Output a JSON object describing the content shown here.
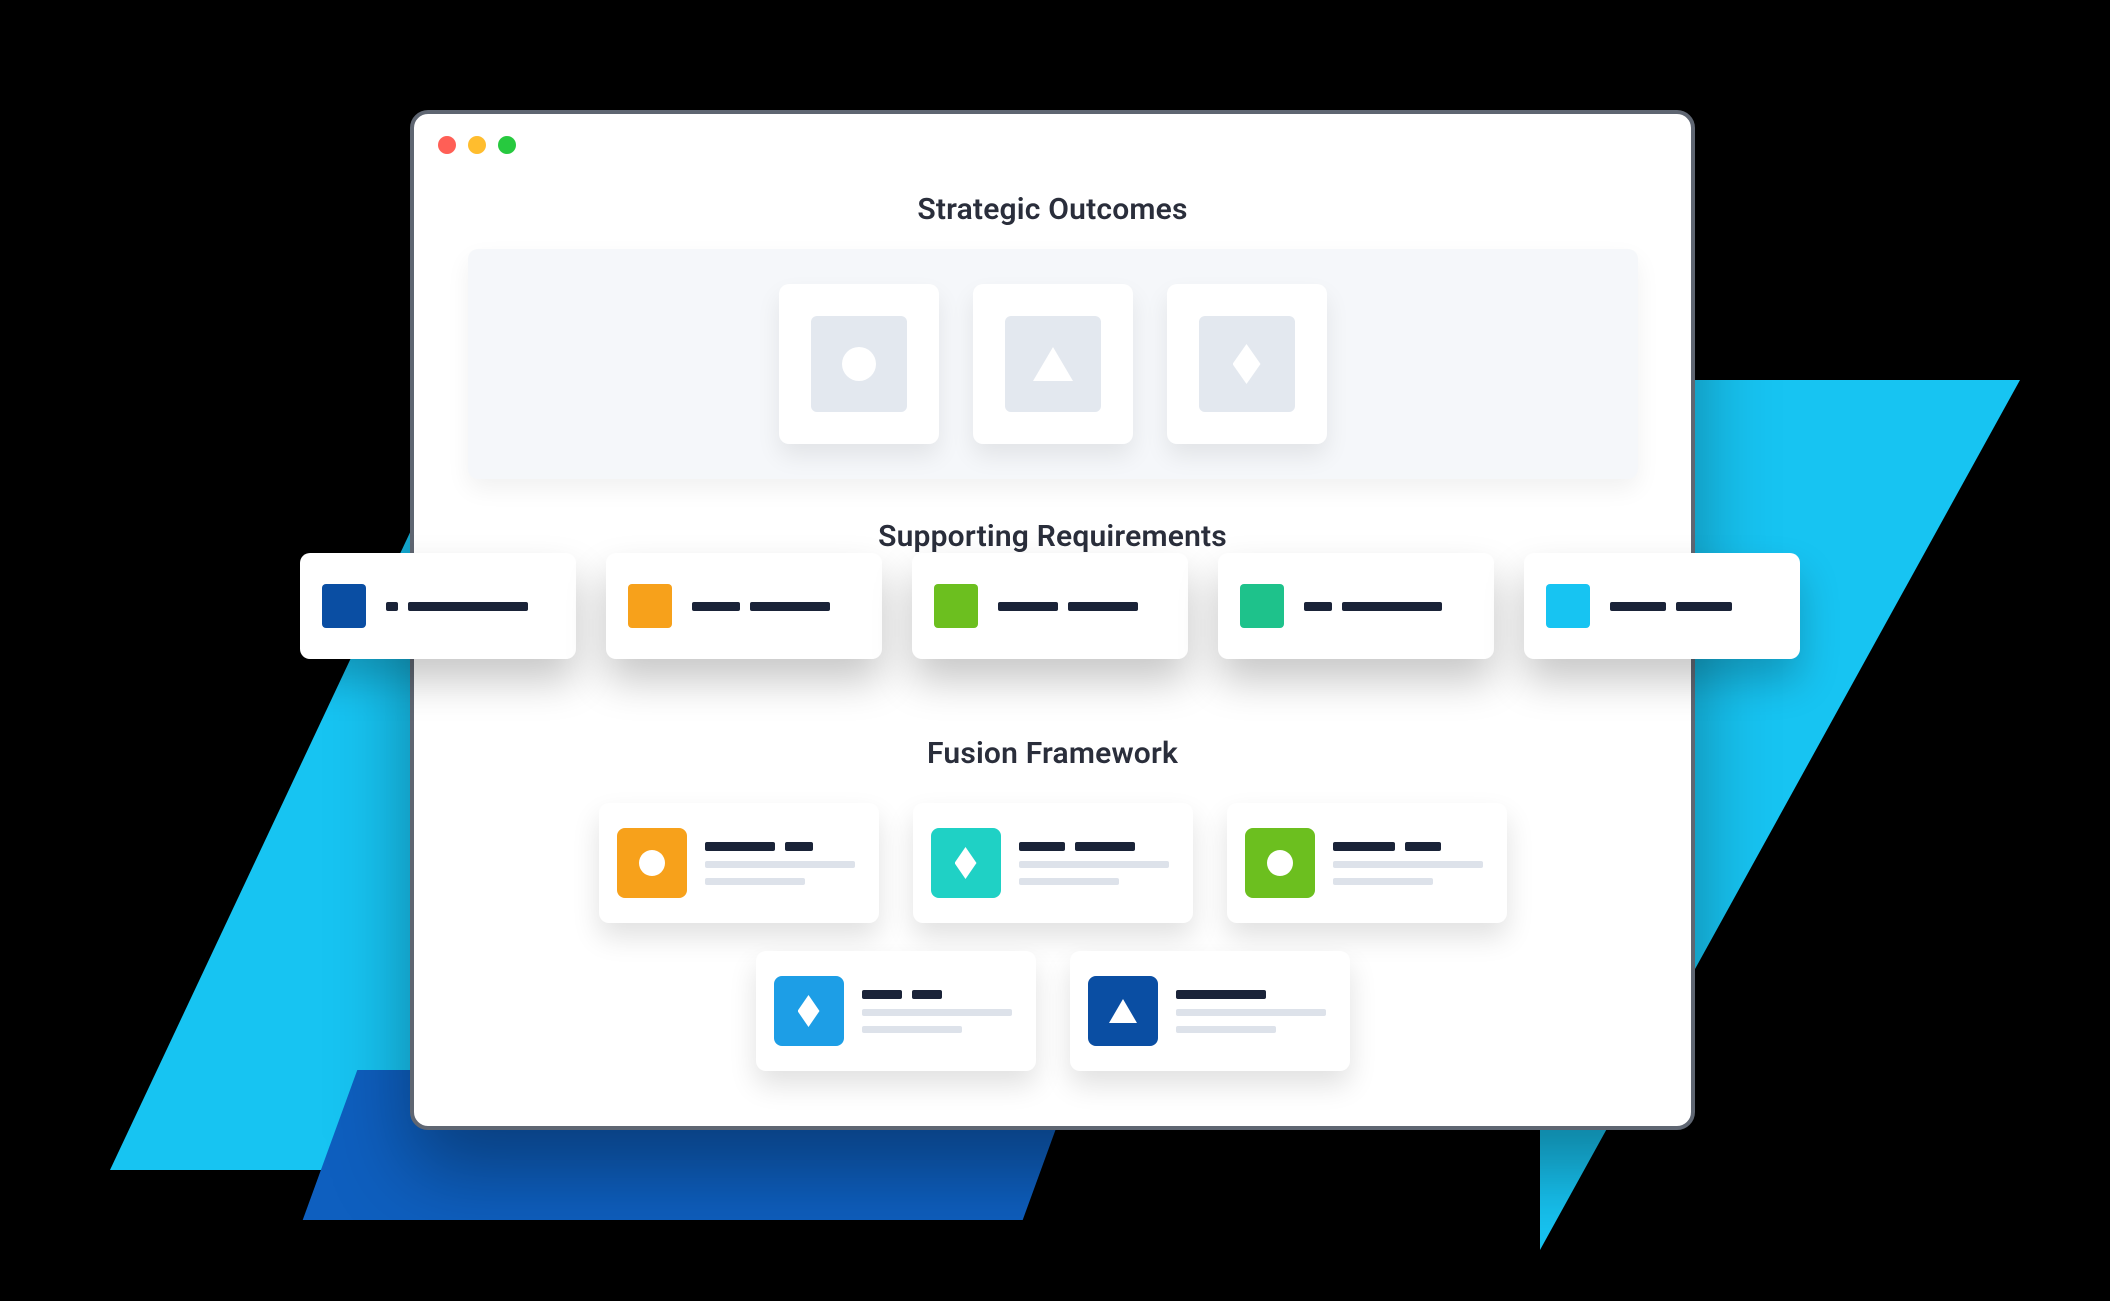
{
  "sections": {
    "strategic_outcomes": {
      "title": "Strategic Outcomes"
    },
    "supporting_requirements": {
      "title": "Supporting Requirements"
    },
    "fusion_framework": {
      "title": "Fusion Framework"
    }
  },
  "strategic_outcomes": {
    "cards": [
      {
        "shape": "circle"
      },
      {
        "shape": "triangle"
      },
      {
        "shape": "diamond"
      }
    ]
  },
  "supporting_requirements": {
    "items": [
      {
        "color": "#0a4ea3"
      },
      {
        "color": "#f7a11b"
      },
      {
        "color": "#6cbf1f"
      },
      {
        "color": "#1ec28b"
      },
      {
        "color": "#17c4f2"
      }
    ]
  },
  "fusion_framework": {
    "row1": [
      {
        "color": "#f7a11b",
        "shape": "circle"
      },
      {
        "color": "#1fd1c5",
        "shape": "diamond"
      },
      {
        "color": "#6cbf1f",
        "shape": "circle"
      }
    ],
    "row2": [
      {
        "color": "#1d9ee6",
        "shape": "diamond"
      },
      {
        "color": "#0a4ea3",
        "shape": "triangle"
      }
    ]
  },
  "colors": {
    "cyan_accent": "#17c4f2",
    "blue_accent": "#0e5fbf",
    "window_border": "#5f6672"
  }
}
